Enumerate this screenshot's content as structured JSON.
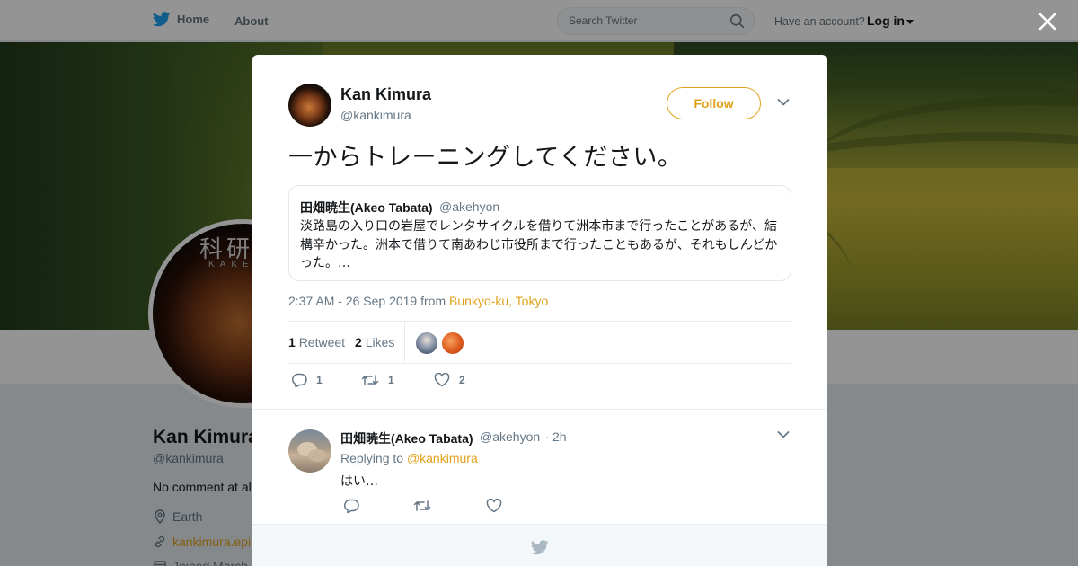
{
  "nav": {
    "home_label": "Home",
    "about_label": "About",
    "search_placeholder": "Search Twitter",
    "have_account": "Have an account?",
    "login_label": "Log in"
  },
  "profile": {
    "name": "Kan Kimura",
    "handle": "@kankimura",
    "bio": "No comment at al",
    "location": "Earth",
    "url": "kankimura.epi",
    "joined": "Joined March",
    "avatar_kanji": "科研",
    "avatar_caption": "KAKE"
  },
  "tweet": {
    "author_name": "Kan Kimura",
    "author_handle": "@kankimura",
    "follow_label": "Follow",
    "text": "一からトレーニングしてください。",
    "quote": {
      "name": "田畑暁生(Akeo Tabata)",
      "handle": "@akehyon",
      "text": "淡路島の入り口の岩屋でレンタサイクルを借りて洲本市まで行ったことがあるが、結構辛かった。洲本で借りて南あわじ市役所まで行ったこともあるが、それもしんどかった。…"
    },
    "timestamp": "2:37 AM - 26 Sep 2019 from ",
    "place": "Bunkyo-ku, Tokyo",
    "retweet_count": "1",
    "retweet_label": "Retweet",
    "like_count": "2",
    "like_label": "Likes",
    "action_reply_count": "1",
    "action_retweet_count": "1",
    "action_like_count": "2"
  },
  "reply": {
    "name": "田畑暁生(Akeo Tabata)",
    "handle": "@akehyon",
    "dot": "·",
    "time": "2h",
    "replying_prefix": "Replying to ",
    "replying_to": "@kankimura",
    "text": "はい…"
  },
  "colors": {
    "accent": "#e1a21a",
    "twitter_blue": "#1da1f2",
    "muted": "#657786"
  },
  "icons": [
    "twitter-bird-icon",
    "search-icon",
    "close-icon",
    "chevron-down-icon",
    "reply-icon",
    "retweet-icon",
    "heart-icon",
    "location-icon",
    "link-icon",
    "calendar-icon"
  ]
}
